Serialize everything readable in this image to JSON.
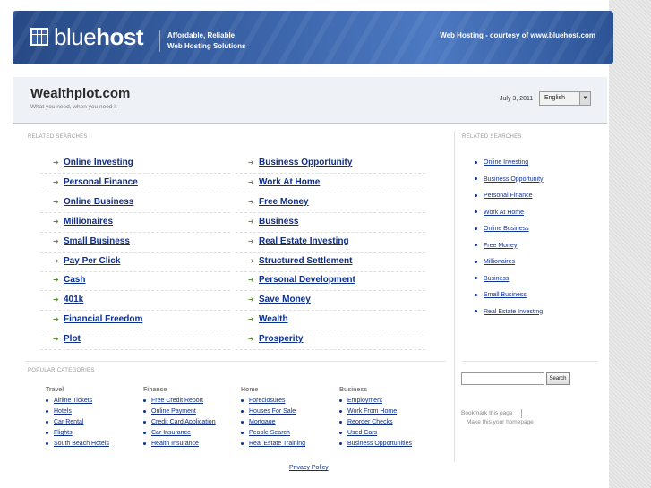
{
  "banner": {
    "brand_light": "blue",
    "brand_bold": "host",
    "tagline_1": "Affordable, Reliable",
    "tagline_2": "Web Hosting Solutions",
    "courtesy": "Web Hosting - courtesy of www.bluehost.com"
  },
  "header": {
    "title": "Wealthplot.com",
    "subtitle": "What you need, when you need it",
    "date": "July 3, 2011",
    "language": "English"
  },
  "main": {
    "related_label": "RELATED SEARCHES",
    "left_links": [
      "Online Investing",
      "Personal Finance",
      "Online Business",
      "Millionaires",
      "Small Business",
      "Pay Per Click",
      "Cash",
      "401k",
      "Financial Freedom",
      "Plot"
    ],
    "right_links": [
      "Business Opportunity",
      "Work At Home",
      "Free Money",
      "Business",
      "Real Estate Investing",
      "Structured Settlement",
      "Personal Development",
      "Save Money",
      "Wealth",
      "Prosperity"
    ]
  },
  "sidebar": {
    "related_label": "RELATED SEARCHES",
    "links": [
      "Online Investing",
      "Business Opportunity",
      "Personal Finance",
      "Work At Home",
      "Online Business",
      "Free Money",
      "Millionaires",
      "Business",
      "Small Business",
      "Real Estate Investing"
    ],
    "search_button": "Search",
    "bookmark": "Bookmark this page",
    "homepage": "Make this your homepage"
  },
  "popular": {
    "label": "POPULAR CATEGORIES",
    "columns": [
      {
        "title": "Travel",
        "items": [
          "Airline Tickets",
          "Hotels",
          "Car Rental",
          "Flights",
          "South Beach Hotels"
        ]
      },
      {
        "title": "Finance",
        "items": [
          "Free Credit Report",
          "Online Payment",
          "Credit Card Application",
          "Car Insurance",
          "Health Insurance"
        ]
      },
      {
        "title": "Home",
        "items": [
          "Foreclosures",
          "Houses For Sale",
          "Mortgage",
          "People Search",
          "Real Estate Training"
        ]
      },
      {
        "title": "Business",
        "items": [
          "Employment",
          "Work From Home",
          "Reorder Checks",
          "Used Cars",
          "Business Opportunities"
        ]
      }
    ]
  },
  "footer": {
    "privacy": "Privacy Policy"
  },
  "colors": {
    "link": "#0d2f8c",
    "banner": "#3a63a8",
    "arrow": "#5c8a3a"
  },
  "icons": {
    "row_arrow": "arrow-right-icon",
    "language": "chevron-down-icon",
    "logo": "grid-logo-icon"
  }
}
